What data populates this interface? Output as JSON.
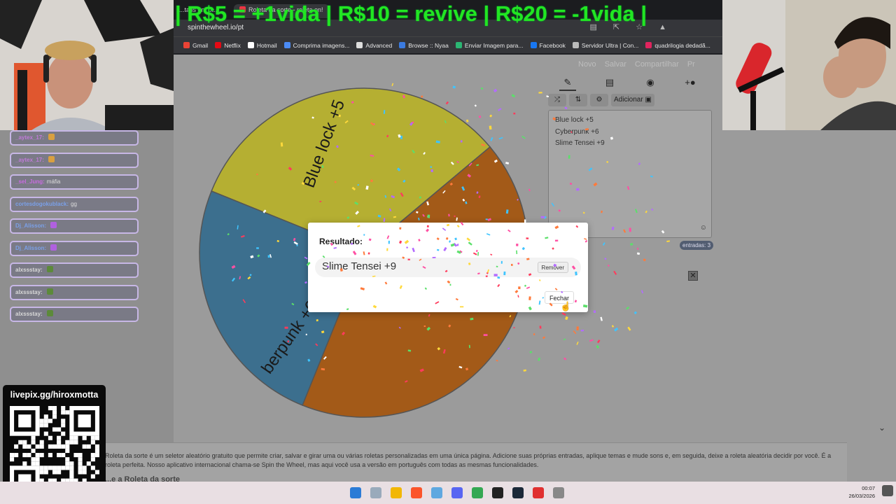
{
  "stream_banner": "| R$5 = +1vida | R$10 = revive | R$20 = -1vida |",
  "browser": {
    "tabs": [
      "...tatis em pt...",
      "Roleta da sorte - roleta on!"
    ],
    "url": "spinthewheel.io/pt",
    "bookmarks": [
      {
        "label": "Gmail",
        "color": "#ea4335"
      },
      {
        "label": "Netflix",
        "color": "#e50914"
      },
      {
        "label": "Hotmail",
        "color": "#ffffff"
      },
      {
        "label": "Comprima imagens...",
        "color": "#4b8bf5"
      },
      {
        "label": "Advanced",
        "color": "#dddddd"
      },
      {
        "label": "Browse :: Nyaa",
        "color": "#3b7be0"
      },
      {
        "label": "Enviar Imagem para...",
        "color": "#2bb673"
      },
      {
        "label": "Facebook",
        "color": "#1877f2"
      },
      {
        "label": "Servidor Ultra | Con...",
        "color": "#bbbbbb"
      },
      {
        "label": "quadrilogia dedadã...",
        "color": "#e0245e"
      }
    ]
  },
  "site": {
    "top_links": [
      "Novo",
      "Salvar",
      "Compartilhar",
      "Pr"
    ],
    "tools": {
      "add_label": "Adicionar"
    },
    "entries": [
      "Blue lock +5",
      "Cyberpunk +6",
      "Slime Tensei +9"
    ],
    "entries_count": "entradas: 3",
    "close_x": "✕",
    "description": "Roleta da sorte é um seletor aleatório gratuito que permite criar, salvar e girar uma ou várias roletas personalizadas em uma única página. Adicione suas próprias entradas, aplique temas e mude sons e, em seguida, deixe a roleta aleatória decidir por você. É a roleta perfeita. Nosso aplicativo internacional chama-se Spin the Wheel, mas aqui você usa a versão em português com todas as mesmas funcionalidades.",
    "section_heading": "...e a Roleta da sorte"
  },
  "wheel": {
    "segments": [
      {
        "label": "Blue lock +5",
        "color": "#b5af32"
      },
      {
        "label": "Slime Tensei +9",
        "color": "#a35a18"
      },
      {
        "label": "Cyberpunk +6",
        "color": "#3c6f8e"
      }
    ],
    "visible_labels": [
      "Blue lock +5",
      "berpunk +6"
    ]
  },
  "dialog": {
    "title": "Resultado:",
    "result": "Slime Tensei +9",
    "remove_label": "Remover",
    "close_label": "Fechar"
  },
  "chat": [
    {
      "user": "_aytex_17:",
      "text": "",
      "user_color": "#c07ad8",
      "emote": "#d9a040"
    },
    {
      "user": "_aytex_17:",
      "text": "",
      "user_color": "#c07ad8",
      "emote": "#d9a040"
    },
    {
      "user": "_sel_Jung:",
      "text": "máfia",
      "user_color": "#c86be0",
      "emote": ""
    },
    {
      "user": "cortesdogokublack:",
      "text": "gg",
      "user_color": "#7aa0e8",
      "emote": ""
    },
    {
      "user": "Dj_Alisson:",
      "text": "",
      "user_color": "#7aa0e8",
      "emote": "#b060e0"
    },
    {
      "user": "Dj_Alisson:",
      "text": "",
      "user_color": "#7aa0e8",
      "emote": "#b060e0"
    },
    {
      "user": "alxssstay:",
      "text": "",
      "user_color": "#d8d8d8",
      "emote": "#5c8a3a"
    },
    {
      "user": "alxssstay:",
      "text": "",
      "user_color": "#d8d8d8",
      "emote": "#5c8a3a"
    },
    {
      "user": "alxssstay:",
      "text": "",
      "user_color": "#d8d8d8",
      "emote": "#5c8a3a"
    }
  ],
  "qr_panel": {
    "title": "livepix.gg/hiroxmotta"
  },
  "taskbar": {
    "time": "00:07",
    "date": "26/03/2026",
    "app_colors": [
      "#2b7bd6",
      "#9ab",
      "#f2b705",
      "#fb542b",
      "#5fa8e0",
      "#5865f2",
      "#34a853",
      "#222222",
      "#1b2838",
      "#e03030",
      "#888888"
    ]
  },
  "colors": {
    "banner": "#22e622",
    "dialog_bg": "#ffffff",
    "chat_border": "#c7b7e6"
  }
}
